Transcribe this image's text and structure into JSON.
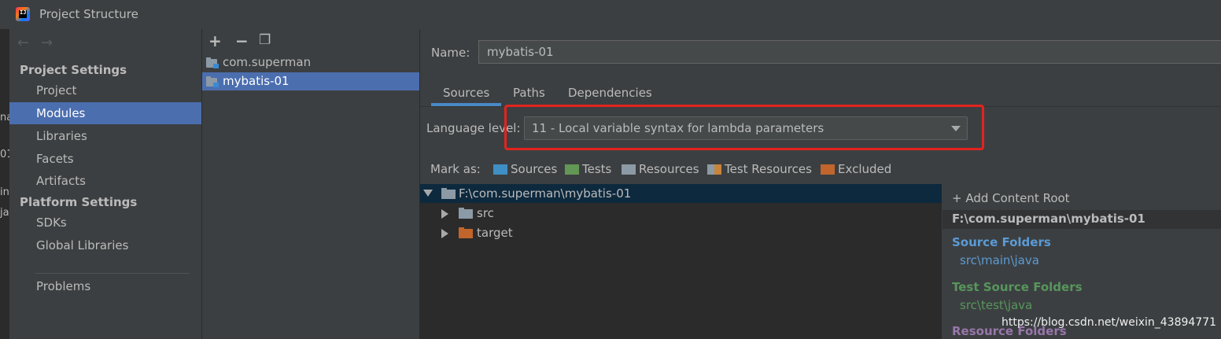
{
  "window": {
    "title": "Project Structure"
  },
  "nav": {
    "back": "←",
    "forward": "→"
  },
  "sidebar": {
    "project_settings": "Project Settings",
    "items_project": [
      "Project",
      "Modules",
      "Libraries",
      "Facets",
      "Artifacts"
    ],
    "platform_settings": "Platform Settings",
    "items_platform": [
      "SDKs",
      "Global Libraries"
    ],
    "problems": "Problems",
    "selected": "Modules"
  },
  "modules": {
    "toolbar": {
      "add": "+",
      "remove": "−",
      "copy": "❐"
    },
    "items": [
      "com.superman",
      "mybatis-01"
    ],
    "selected": "mybatis-01"
  },
  "editor": {
    "name_label": "Name:",
    "name_value": "mybatis-01",
    "tabs": [
      "Sources",
      "Paths",
      "Dependencies"
    ],
    "active_tab": "Sources",
    "language_label": "Language level:",
    "language_value": "11 - Local variable syntax for lambda parameters",
    "mark_as_label": "Mark as:",
    "mark_as": [
      {
        "label": "Sources",
        "color": "#3f8fc4"
      },
      {
        "label": "Tests",
        "color": "#629755"
      },
      {
        "label": "Resources",
        "color": "#8c9aa6"
      },
      {
        "label": "Test Resources",
        "color": "#8c9aa6"
      },
      {
        "label": "Excluded",
        "color": "#c1652c"
      }
    ]
  },
  "tree": {
    "root": "F:\\com.superman\\mybatis-01",
    "children": [
      {
        "label": "src",
        "color": "#8c9aa6"
      },
      {
        "label": "target",
        "color": "#c1652c"
      }
    ]
  },
  "roots": {
    "add": "+ Add Content Root",
    "path": "F:\\com.superman\\mybatis-01",
    "source_folders": {
      "title": "Source Folders",
      "value": "src\\main\\java",
      "color": "#5b9bd5"
    },
    "test_source_folders": {
      "title": "Test Source Folders",
      "value": "src\\test\\java",
      "color": "#57965c"
    },
    "resource_folders": {
      "title": "Resource Folders",
      "color": "#9876aa"
    }
  },
  "watermark": "https://blog.csdn.net/weixin_43894771"
}
